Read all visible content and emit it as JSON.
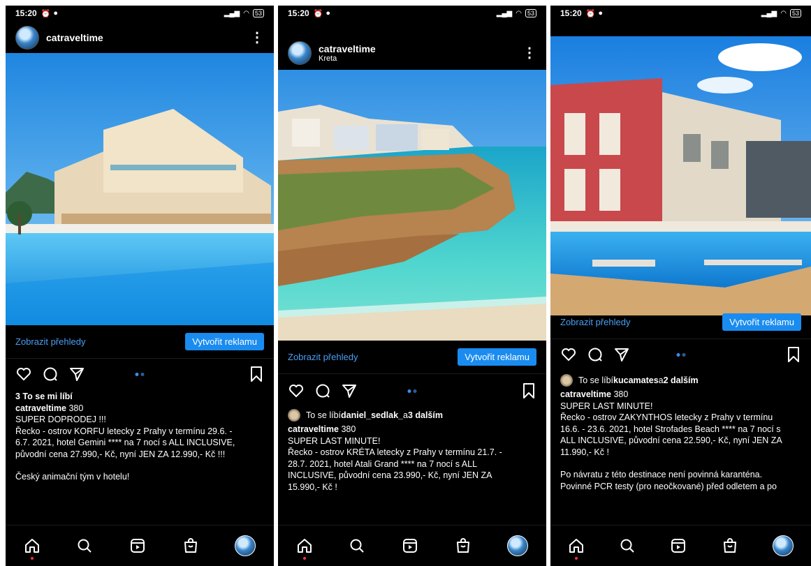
{
  "screens": [
    {
      "status": {
        "time": "15:20",
        "battery": "53"
      },
      "header": {
        "username": "catraveltime",
        "location": ""
      },
      "insights_label": "Zobrazit přehledy",
      "promote_label": "Vytvořit reklamu",
      "likes": {
        "prefix": "",
        "text": "3 To se mi líbí",
        "name": "",
        "suffix": ""
      },
      "caption": {
        "user": "catraveltime",
        "count": "380",
        "lines": [
          "SUPER DOPRODEJ !!!",
          "Řecko - ostrov KORFU letecky z Prahy v termínu  29.6. -",
          "6.7. 2021, hotel Gemini **** na 7 nocí s ALL INCLUSIVE,",
          "původní cena 27.990,- Kč,  nyní JEN ZA 12.990,- Kč !!!",
          "",
          "Český animační tým v hotelu!"
        ]
      }
    },
    {
      "status": {
        "time": "15:20",
        "battery": "53"
      },
      "header": {
        "username": "catraveltime",
        "location": "Kreta"
      },
      "insights_label": "Zobrazit přehledy",
      "promote_label": "Vytvořit reklamu",
      "likes": {
        "prefix": "To se líbí ",
        "name": "daniel_sedlak_",
        "mid": " a ",
        "suffix": "3 dalším"
      },
      "caption": {
        "user": "catraveltime",
        "count": "380",
        "lines": [
          "SUPER LAST MINUTE!",
          "Řecko - ostrov KRÉTA letecky z Prahy v termínu 21.7. -",
          "28.7. 2021, hotel Atali Grand **** na 7 nocí s ALL",
          "INCLUSIVE, původní cena 23.990,- Kč,  nyní JEN ZA",
          "15.990,- Kč !"
        ]
      }
    },
    {
      "status": {
        "time": "15:20",
        "battery": "53"
      },
      "header": {
        "username": "",
        "location": ""
      },
      "insights_label": "Zobrazit přehledy",
      "promote_label": "Vytvořit reklamu",
      "likes": {
        "prefix": "To se líbí ",
        "name": "kucamates",
        "mid": " a ",
        "suffix": "2 dalším"
      },
      "caption": {
        "user": "catraveltime",
        "count": "380",
        "lines": [
          "SUPER LAST MINUTE!",
          "Řecko - ostrov ZAKYNTHOS letecky z Prahy v termínu",
          "16.6. - 23.6. 2021, hotel Strofades Beach **** na 7 nocí s",
          "ALL INCLUSIVE, původní cena 22.590,- Kč,  nyní JEN ZA",
          "11.990,- Kč !",
          "",
          "Po návratu z této destinace není povinná karanténa.",
          "Povinné PCR testy (pro neočkované) před odletem a po"
        ]
      }
    }
  ],
  "icons": {
    "like": "heart-icon",
    "comment": "comment-icon",
    "share": "send-icon",
    "save": "bookmark-icon",
    "nav": [
      "home-icon",
      "search-icon",
      "reels-icon",
      "shop-icon",
      "profile-avatar"
    ]
  },
  "colors": {
    "link": "#4a9ff5",
    "button": "#1a8cf0",
    "background": "#000000"
  }
}
